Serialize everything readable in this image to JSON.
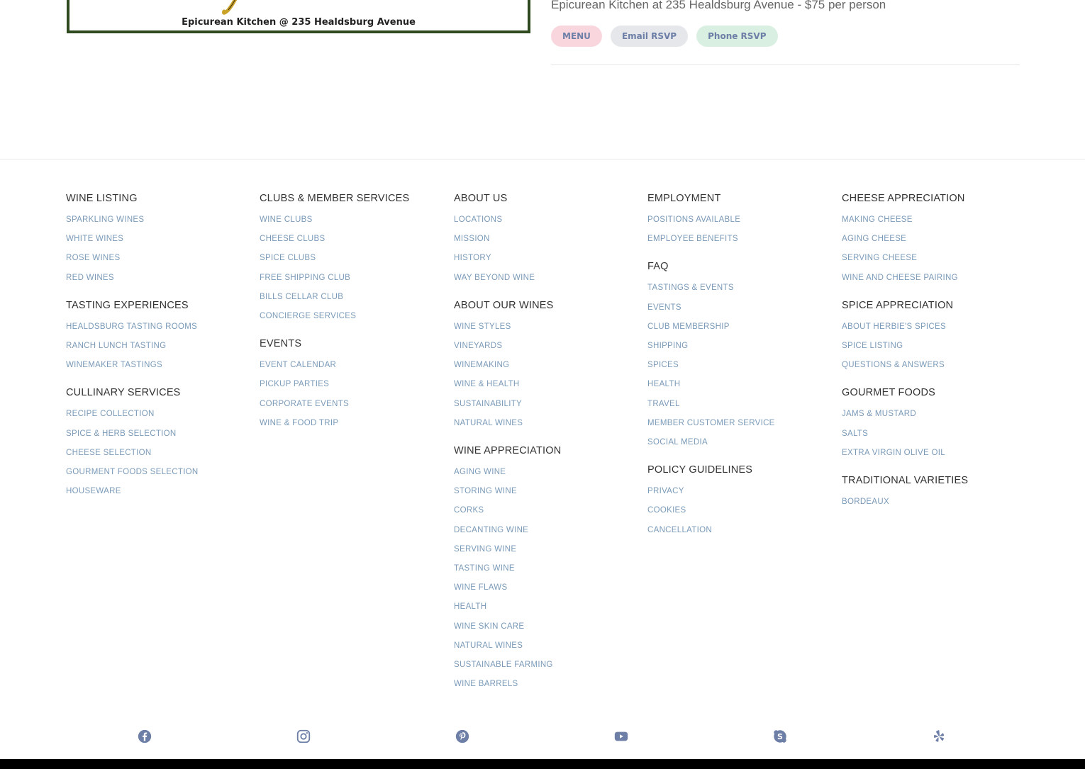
{
  "event": {
    "image_caption": "Epicurean Kitchen @ 235 Healdsburg Avenue",
    "title": "Epicurean Kitchen at 235 Healdsburg Avenue - $75 per person",
    "buttons": {
      "menu": "MENU",
      "email": "Email RSVP",
      "phone": "Phone RSVP"
    }
  },
  "footer": {
    "columns": [
      [
        {
          "heading": "WINE LISTING",
          "links": [
            "SPARKLING WINES",
            "WHITE WINES",
            "ROSE WINES",
            "RED WINES"
          ]
        },
        {
          "heading": "TASTING EXPERIENCES",
          "links": [
            "HEALDSBURG TASTING ROOMS",
            "RANCH LUNCH TASTING",
            "WINEMAKER TASTINGS"
          ]
        },
        {
          "heading": "CULLINARY SERVICES",
          "links": [
            "RECIPE COLLECTION",
            "SPICE & HERB SELECTION",
            "CHEESE SELECTION",
            "GOURMENT FOODS SELECTION",
            "HOUSEWARE"
          ]
        }
      ],
      [
        {
          "heading": "CLUBS & MEMBER SERVICES",
          "links": [
            "WINE CLUBS",
            "CHEESE CLUBS",
            "SPICE CLUBS",
            "FREE SHIPPING CLUB",
            "BILLS CELLAR CLUB",
            "CONCIERGE SERVICES"
          ]
        },
        {
          "heading": "EVENTS",
          "links": [
            "EVENT CALENDAR",
            "PICKUP PARTIES",
            "CORPORATE EVENTS",
            "WINE & FOOD TRIP"
          ]
        }
      ],
      [
        {
          "heading": "ABOUT US",
          "links": [
            "LOCATIONS",
            "MISSION",
            "HISTORY",
            "WAY BEYOND WINE"
          ]
        },
        {
          "heading": "ABOUT OUR WINES",
          "links": [
            "WINE STYLES",
            "VINEYARDS",
            "WINEMAKING",
            "WINE & HEALTH",
            "SUSTAINABILITY",
            "NATURAL WINES"
          ]
        },
        {
          "heading": "WINE APPRECIATION",
          "links": [
            "AGING WINE",
            "STORING WINE",
            "CORKS",
            "DECANTING WINE",
            "SERVING WINE",
            "TASTING WINE",
            "WINE FLAWS",
            "HEALTH",
            "WINE SKIN CARE",
            "NATURAL WINES",
            "SUSTAINABLE FARMING",
            "WINE BARRELS"
          ]
        }
      ],
      [
        {
          "heading": "EMPLOYMENT",
          "links": [
            "POSITIONS AVAILABLE",
            "EMPLOYEE BENEFITS"
          ]
        },
        {
          "heading": "FAQ",
          "links": [
            "TASTINGS & EVENTS",
            "EVENTS",
            "CLUB MEMBERSHIP",
            "SHIPPING",
            "SPICES",
            "HEALTH",
            "TRAVEL",
            "MEMBER CUSTOMER SERVICE",
            "SOCIAL MEDIA"
          ]
        },
        {
          "heading": "POLICY GUIDELINES",
          "links": [
            "PRIVACY",
            "COOKIES",
            "CANCELLATION"
          ]
        }
      ],
      [
        {
          "heading": "CHEESE APPRECIATION",
          "links": [
            "MAKING CHEESE",
            "AGING CHEESE",
            "SERVING CHEESE",
            "WINE AND CHEESE PAIRING"
          ]
        },
        {
          "heading": "SPICE APPRECIATION",
          "links": [
            "ABOUT HERBIE'S SPICES",
            "SPICE LISTING",
            "QUESTIONS & ANSWERS"
          ]
        },
        {
          "heading": "GOURMET FOODS",
          "links": [
            "JAMS & MUSTARD",
            "SALTS",
            "EXTRA VIRGIN OLIVE OIL"
          ]
        },
        {
          "heading": "TRADITIONAL VARIETIES",
          "links": [
            "BORDEAUX"
          ]
        }
      ]
    ],
    "social_icons": [
      "facebook-icon",
      "instagram-icon",
      "pinterest-icon",
      "youtube-icon",
      "skype-icon",
      "yelp-icon"
    ]
  },
  "colors": {
    "link": "#7a9ab8",
    "heading": "#333333",
    "icon": "#6d7fa6",
    "menu_pill": "#f9d6de",
    "email_pill": "#e5e7eb",
    "phone_pill": "#d9efe1"
  }
}
